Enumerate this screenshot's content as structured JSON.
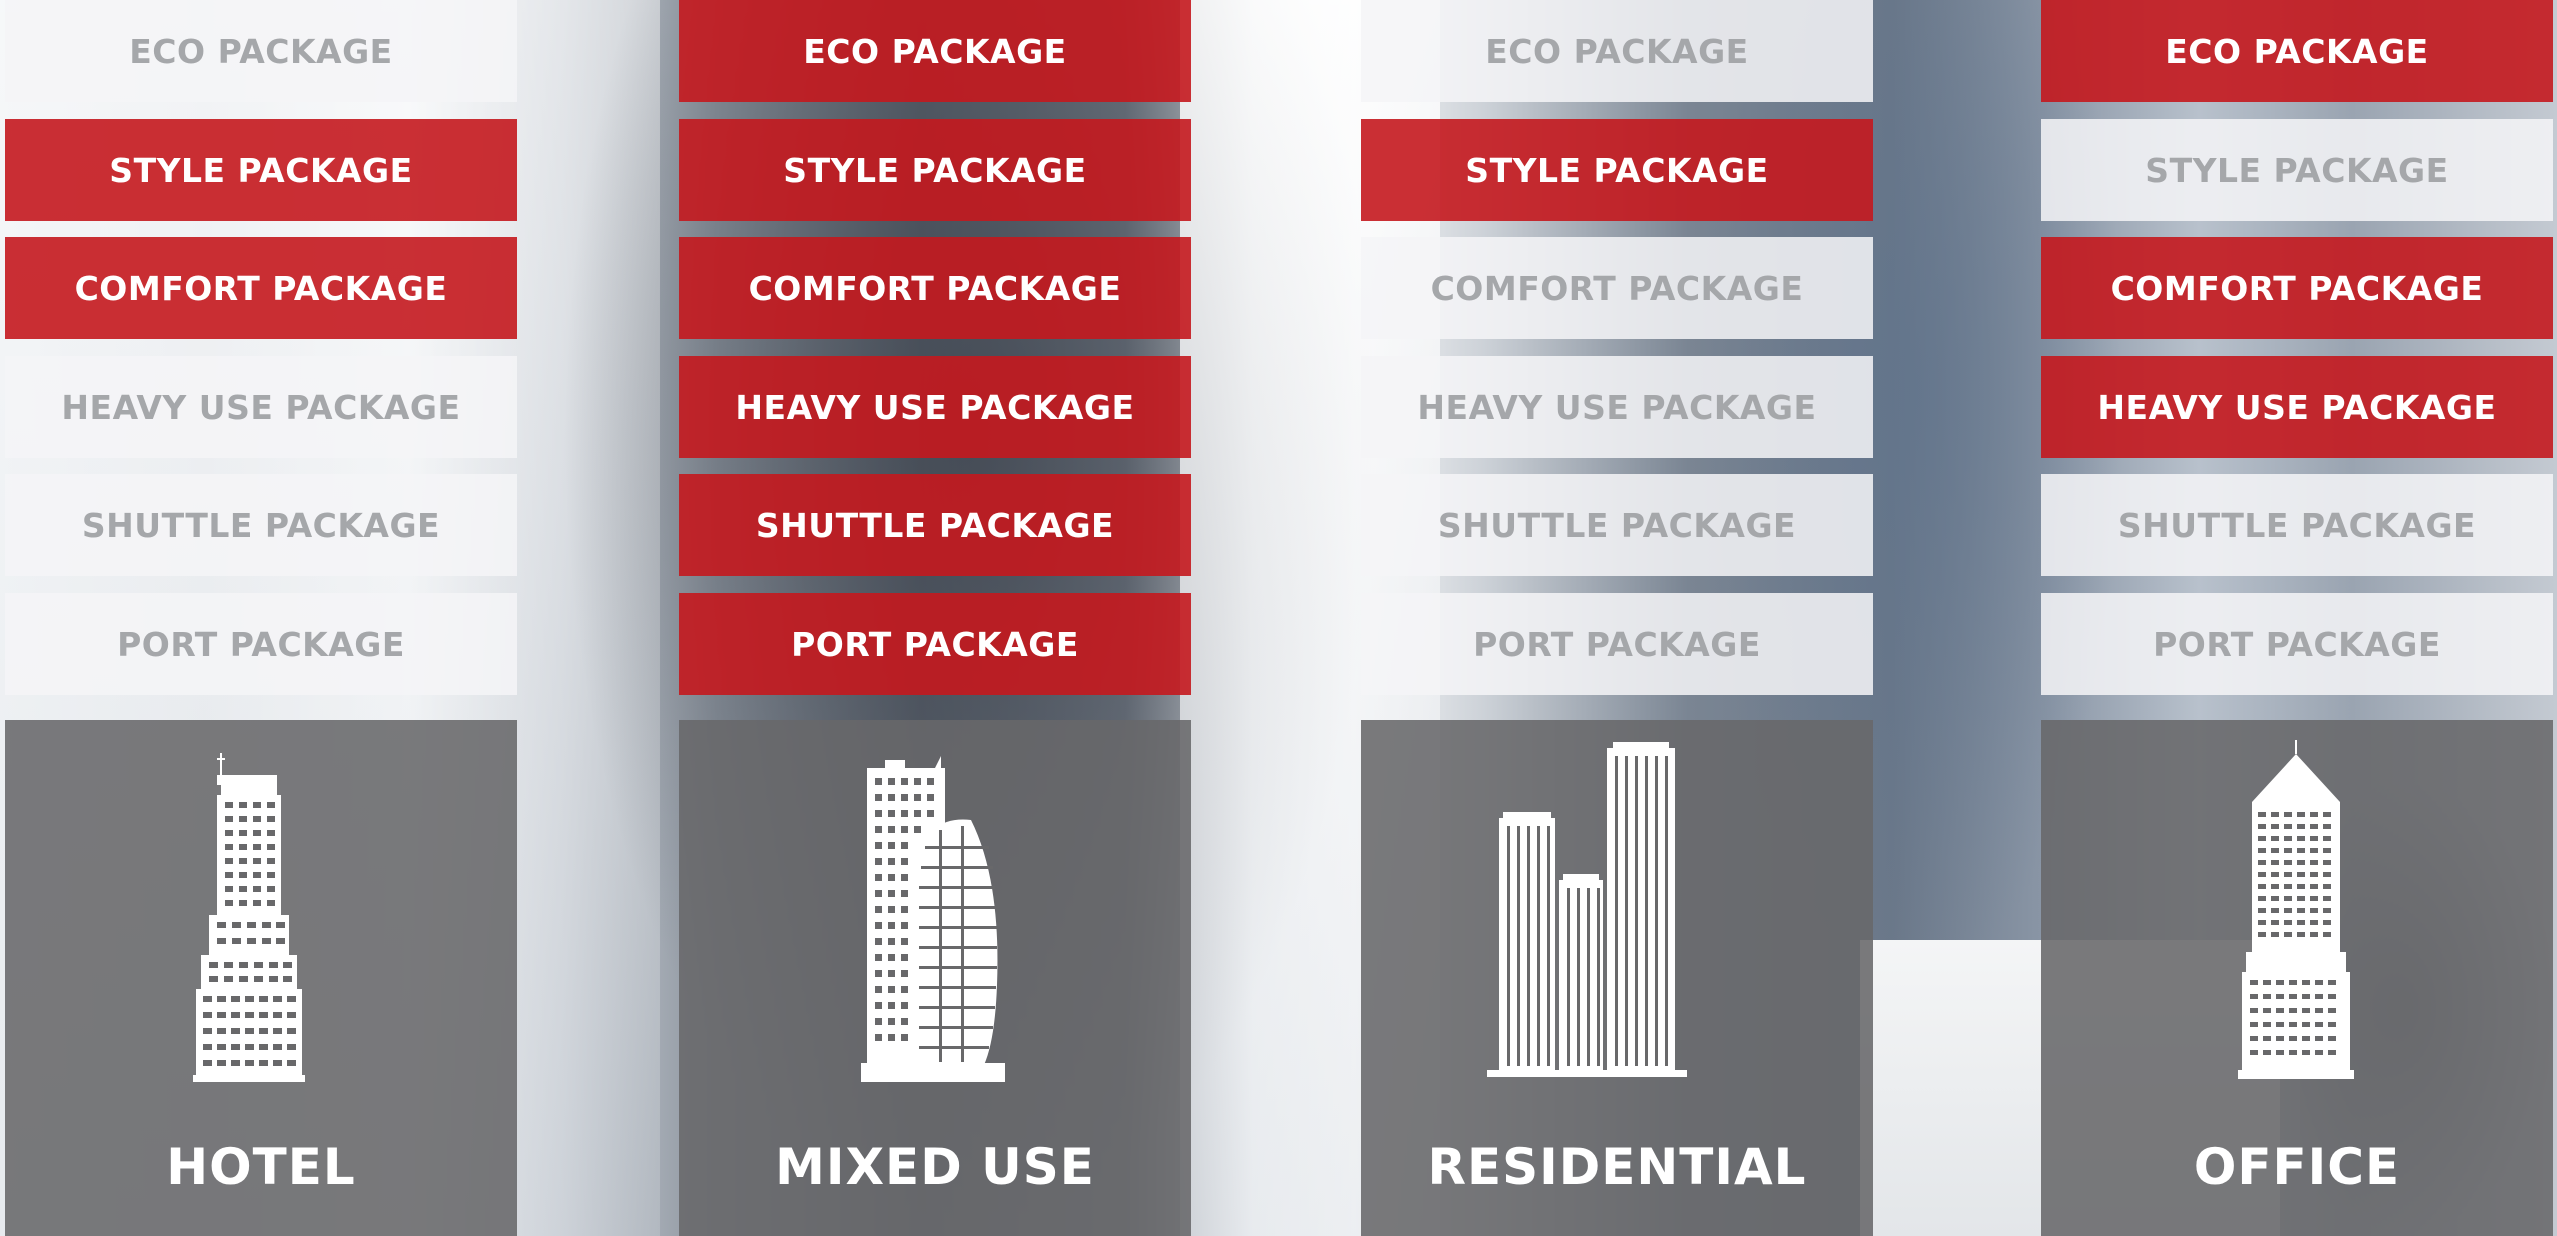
{
  "colors": {
    "active": "#c4181e",
    "inactive_bg": "#f4f5f7",
    "inactive_text": "#a5a7aa",
    "panel": "#68686a"
  },
  "columns": [
    {
      "label": "HOTEL",
      "icon": "hotel-building-icon",
      "packages": [
        {
          "label": "ECO PACKAGE",
          "active": false
        },
        {
          "label": "STYLE PACKAGE",
          "active": true
        },
        {
          "label": "COMFORT PACKAGE",
          "active": true
        },
        {
          "label": "HEAVY USE PACKAGE",
          "active": false
        },
        {
          "label": "SHUTTLE PACKAGE",
          "active": false
        },
        {
          "label": "PORT PACKAGE",
          "active": false
        }
      ]
    },
    {
      "label": "MIXED USE",
      "icon": "mixed-use-building-icon",
      "packages": [
        {
          "label": "ECO PACKAGE",
          "active": true
        },
        {
          "label": "STYLE PACKAGE",
          "active": true
        },
        {
          "label": "COMFORT PACKAGE",
          "active": true
        },
        {
          "label": "HEAVY USE PACKAGE",
          "active": true
        },
        {
          "label": "SHUTTLE PACKAGE",
          "active": true
        },
        {
          "label": "PORT PACKAGE",
          "active": true
        }
      ]
    },
    {
      "label": "RESIDENTIAL",
      "icon": "residential-building-icon",
      "packages": [
        {
          "label": "ECO PACKAGE",
          "active": false
        },
        {
          "label": "STYLE PACKAGE",
          "active": true
        },
        {
          "label": "COMFORT PACKAGE",
          "active": false
        },
        {
          "label": "HEAVY USE PACKAGE",
          "active": false
        },
        {
          "label": "SHUTTLE PACKAGE",
          "active": false
        },
        {
          "label": "PORT PACKAGE",
          "active": false
        }
      ]
    },
    {
      "label": "OFFICE",
      "icon": "office-building-icon",
      "packages": [
        {
          "label": "ECO PACKAGE",
          "active": true
        },
        {
          "label": "STYLE PACKAGE",
          "active": false
        },
        {
          "label": "COMFORT PACKAGE",
          "active": true
        },
        {
          "label": "HEAVY USE PACKAGE",
          "active": true
        },
        {
          "label": "SHUTTLE PACKAGE",
          "active": false
        },
        {
          "label": "PORT PACKAGE",
          "active": false
        }
      ]
    }
  ]
}
